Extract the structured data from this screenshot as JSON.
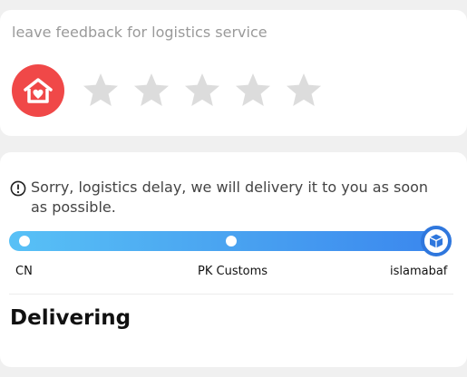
{
  "feedback": {
    "title": "leave feedback for logistics service",
    "rating": 0,
    "max_rating": 5,
    "avatar_icon": "house-heart-icon",
    "star_icon": "star-icon",
    "avatar_color": "#f04848",
    "star_color": "#dcdcdc"
  },
  "logistics": {
    "notice_icon": "info-icon",
    "notice": "Sorry, logistics delay, we will delivery it to you as soon as possible.",
    "progress": 1.0,
    "stages": [
      "CN",
      "PK Customs",
      "islamabaf"
    ],
    "current_stage_icon": "package-icon",
    "status": "Delivering",
    "accent_color": "#3a86ee"
  }
}
